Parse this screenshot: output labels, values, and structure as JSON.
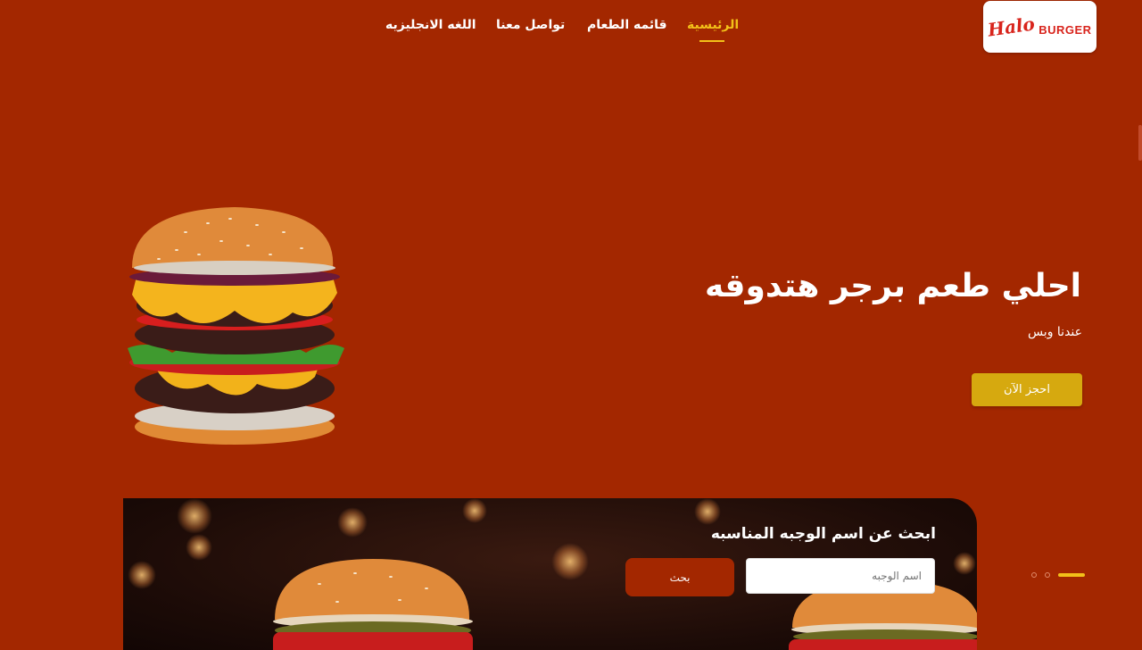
{
  "brand": {
    "script": "Halo",
    "word": "BURGER"
  },
  "nav": {
    "items": [
      {
        "label": "الرئيسية",
        "active": true
      },
      {
        "label": "قائمه الطعام"
      },
      {
        "label": "تواصل معنا"
      },
      {
        "label": "اللغه الانجليزيه"
      }
    ]
  },
  "hero": {
    "title": "احلي طعم برجر هتدوقه",
    "subtitle": "عندنا وبس",
    "cta_label": "احجز الآن"
  },
  "search": {
    "title": "ابحث عن اسم الوجبه المناسبه",
    "placeholder": "اسم الوجبه",
    "button_label": "بحث"
  },
  "slider": {
    "count": 3,
    "active_index": 0
  },
  "colors": {
    "background": "#a32700",
    "accent": "#f2c019",
    "button": "#d6a90f"
  }
}
